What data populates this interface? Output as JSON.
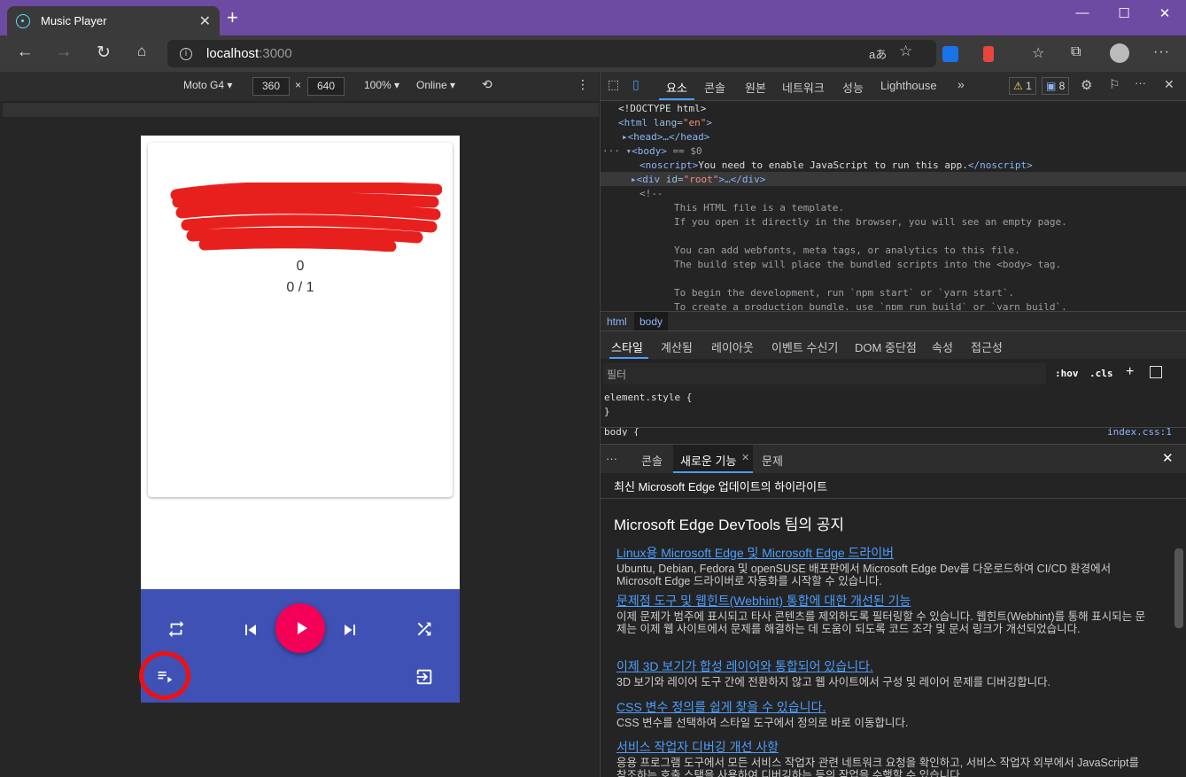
{
  "browser": {
    "tab_title": "Music Player",
    "url_host": "localhost",
    "url_port": ":3000",
    "font_badge": "aあ"
  },
  "device_toolbar": {
    "device": "Moto G4",
    "width": "360",
    "x": "×",
    "height": "640",
    "zoom": "100%",
    "network": "Online"
  },
  "app": {
    "counter": "0",
    "position": "0 / 1",
    "colors": {
      "bar": "#3f51b5",
      "play": "#f50057"
    }
  },
  "devtools": {
    "tabs": [
      "요소",
      "콘솔",
      "원본",
      "네트워크",
      "성능",
      "Lighthouse"
    ],
    "warn_count": "1",
    "msg_count": "8",
    "dom_lines": {
      "l1": "<!DOCTYPE html>",
      "l2a": "<html",
      "l2b": " lang=",
      "l2c": "\"en\"",
      "l2d": ">",
      "l3": "<head>…</head>",
      "l4": "<body>",
      "l4b": " == $0",
      "l5a": "<noscript>",
      "l5b": "You need to enable JavaScript to run this app.",
      "l5c": "</noscript>",
      "l6a": "<div",
      "l6b": " id=",
      "l6c": "\"root\"",
      "l6d": ">…</div>",
      "l7": "<!--",
      "c1": "This HTML file is a template.",
      "c2": "If you open it directly in the browser, you will see an empty page.",
      "c3": "You can add webfonts, meta tags, or analytics to this file.",
      "c4": "The build step will place the bundled scripts into the <body> tag.",
      "c5": "To begin the development, run `npm start` or `yarn start`.",
      "c6": "To create a production bundle, use `npm run build` or `yarn build`."
    },
    "crumbs": [
      "html",
      "body"
    ],
    "style_tabs": [
      "스타일",
      "계산됨",
      "레이아웃",
      "이벤트 수신기",
      "DOM 중단점",
      "속성",
      "접근성"
    ],
    "filter_placeholder": "필터",
    "hov": ":hov",
    "cls": ".cls",
    "element_style": "element.style {",
    "close_brace": "}",
    "body_rule": "body {",
    "source": "index.css:1",
    "drawer_tabs": [
      "콘솔",
      "새로운 기능",
      "문제"
    ],
    "drawer_header": "최신 Microsoft Edge 업데이트의 하이라이트",
    "drawer_title": "Microsoft Edge DevTools 팀의 공지",
    "items": [
      {
        "link": "Linux용 Microsoft Edge 및 Microsoft Edge 드라이버",
        "desc": "Ubuntu, Debian, Fedora 및 openSUSE 배포판에서 Microsoft Edge Dev를 다운로드하여 CI/CD 환경에서 Microsoft Edge 드라이버로 자동화를 시작할 수 있습니다."
      },
      {
        "link": "문제점 도구 및 웹힌트(Webhint) 통합에 대한 개선된 기능",
        "desc": "이제 문제가 범주에 표시되고 타사 콘텐츠를 제외하도록 필터링할 수 있습니다. 웹힌트(Webhint)를 통해 표시되는 문제는 이제 웹 사이트에서 문제를 해결하는 데 도움이 되도록 코드 조각 및 문서 링크가 개선되었습니다."
      },
      {
        "link": "이제 3D 보기가 합성 레이어와 통합되어 있습니다.",
        "desc": "3D 보기와 레이어 도구 간에 전환하지 않고 웹 사이트에서 구성 및 레이어 문제를 디버깅합니다."
      },
      {
        "link": "CSS 변수 정의를 쉽게 찾을 수 있습니다.",
        "desc": "CSS 변수를 선택하여 스타일 도구에서 정의로 바로 이동합니다."
      },
      {
        "link": "서비스 작업자 디버깅 개선 사항",
        "desc": "응용 프로그램 도구에서 모든 서비스 작업자 관련 네트워크 요청을 확인하고, 서비스 작업자 외부에서 JavaScript를 참조하는 호출 스택을 사용하여 디버깅하는 등의 작업을 수행할 수 있습니다."
      }
    ]
  }
}
